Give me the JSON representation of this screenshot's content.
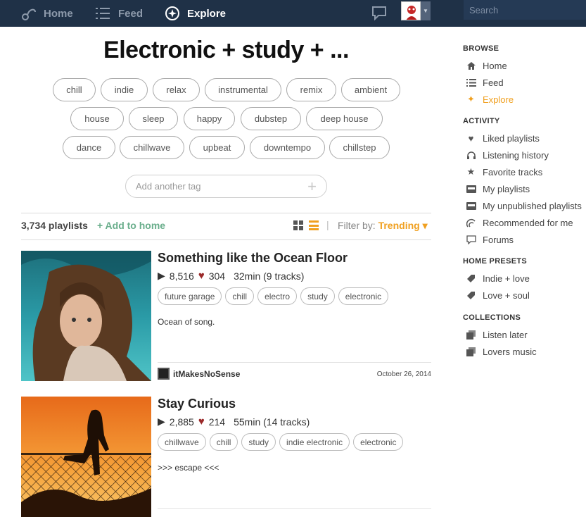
{
  "nav": {
    "home": "Home",
    "feed": "Feed",
    "explore": "Explore",
    "search_placeholder": "Search"
  },
  "page": {
    "title": "Electronic + study + ...",
    "tags": [
      "chill",
      "indie",
      "relax",
      "instrumental",
      "remix",
      "ambient",
      "house",
      "sleep",
      "happy",
      "dubstep",
      "deep house",
      "dance",
      "chillwave",
      "upbeat",
      "downtempo",
      "chillstep"
    ],
    "add_tag_placeholder": "Add another tag"
  },
  "toolbar": {
    "count": "3,734 playlists",
    "add_to_home": "+ Add to home",
    "filter_label": "Filter by:",
    "filter_value": "Trending"
  },
  "playlists": [
    {
      "title": "Something like the Ocean Floor",
      "plays": "8,516",
      "likes": "304",
      "duration": "32min (9 tracks)",
      "tags": [
        "future garage",
        "chill",
        "electro",
        "study",
        "electronic"
      ],
      "description": "Ocean of song.",
      "author": "itMakesNoSense",
      "date": "October 26, 2014"
    },
    {
      "title": "Stay Curious",
      "plays": "2,885",
      "likes": "214",
      "duration": "55min (14 tracks)",
      "tags": [
        "chillwave",
        "chill",
        "study",
        "indie electronic",
        "electronic"
      ],
      "description": ">>> escape <<<"
    }
  ],
  "sidebar": {
    "browse_heading": "BROWSE",
    "browse": [
      "Home",
      "Feed",
      "Explore"
    ],
    "activity_heading": "ACTIVITY",
    "activity": [
      "Liked playlists",
      "Listening history",
      "Favorite tracks",
      "My playlists",
      "My unpublished playlists",
      "Recommended for me",
      "Forums"
    ],
    "presets_heading": "HOME PRESETS",
    "presets": [
      "Indie + love",
      "Love + soul"
    ],
    "collections_heading": "COLLECTIONS",
    "collections": [
      "Listen later",
      "Lovers music"
    ]
  },
  "colors": {
    "topbar": "#1f3147",
    "accent": "#f0a020",
    "add_home": "#6aae8c",
    "heart": "#9b2a2a"
  }
}
